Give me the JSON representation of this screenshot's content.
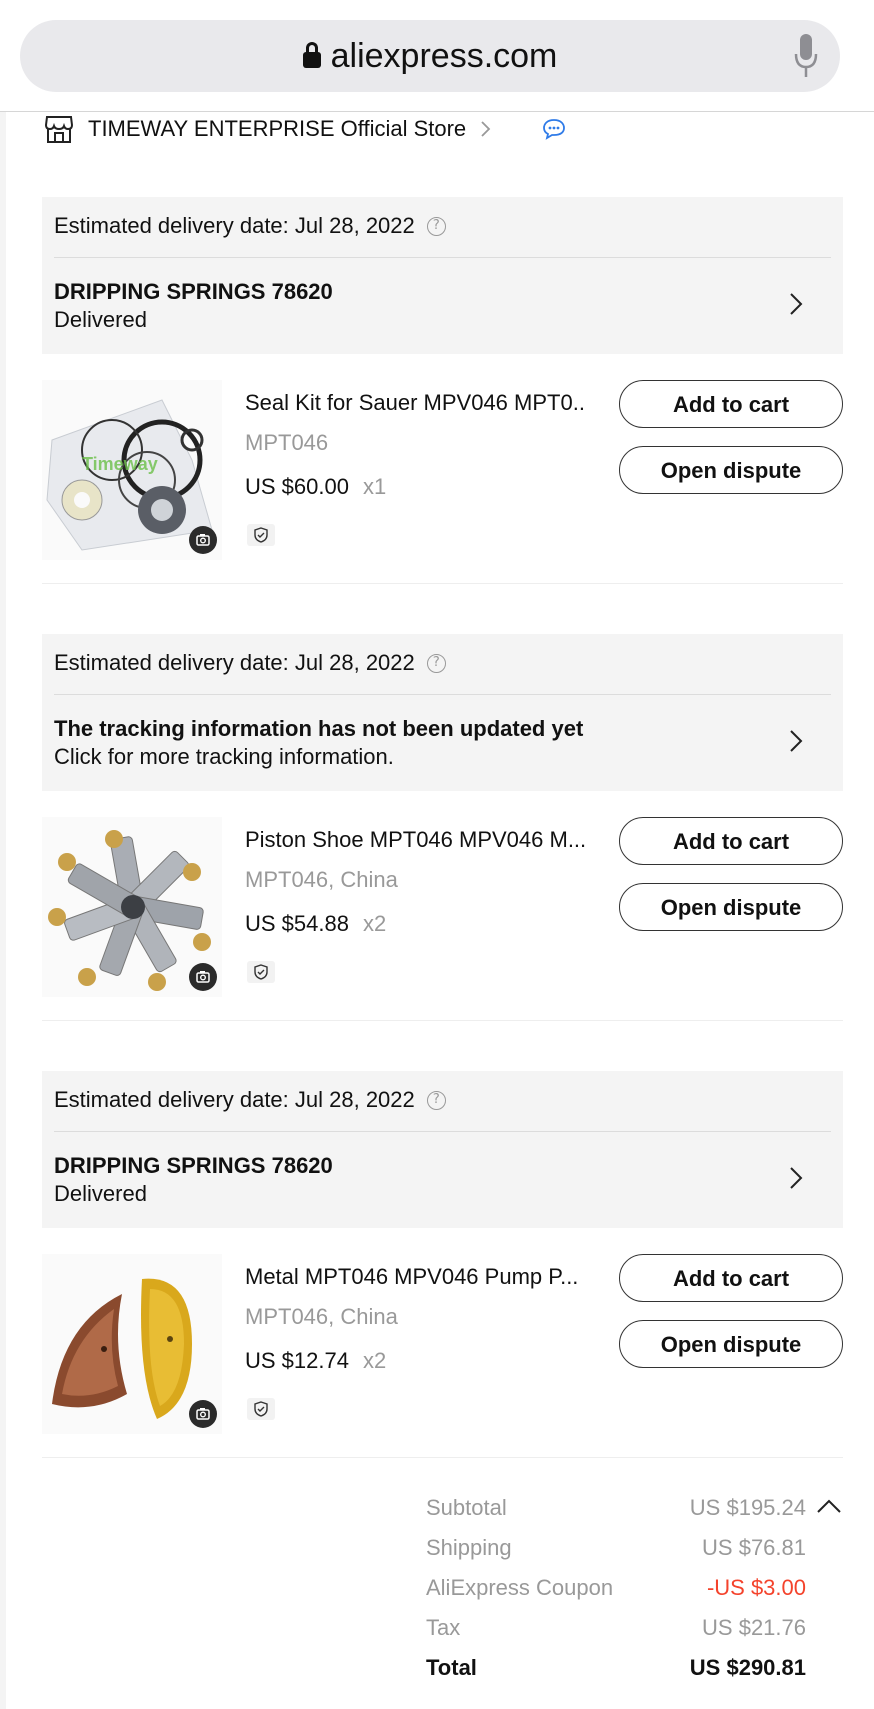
{
  "browser": {
    "url": "aliexpress.com"
  },
  "store": {
    "name": "TIMEWAY ENTERPRISE Official Store"
  },
  "packages": [
    {
      "estimated_delivery": "Estimated delivery date: Jul 28, 2022",
      "tracking_title": "DRIPPING SPRINGS 78620",
      "tracking_status": "Delivered",
      "item": {
        "title": "Seal Kit for Sauer MPV046 MPT0...",
        "variant": "MPT046",
        "price": "US $60.00",
        "quantity": "x1",
        "add_to_cart": "Add to cart",
        "open_dispute": "Open dispute"
      }
    },
    {
      "estimated_delivery": "Estimated delivery date: Jul 28, 2022",
      "tracking_title": "The tracking information has not been updated yet",
      "tracking_status": "Click for more tracking information.",
      "item": {
        "title": "Piston Shoe MPT046 MPV046 M...",
        "variant": "MPT046, China",
        "price": "US $54.88",
        "quantity": "x2",
        "add_to_cart": "Add to cart",
        "open_dispute": "Open dispute"
      }
    },
    {
      "estimated_delivery": "Estimated delivery date: Jul 28, 2022",
      "tracking_title": "DRIPPING SPRINGS 78620",
      "tracking_status": "Delivered",
      "item": {
        "title": "Metal MPT046 MPV046 Pump P...",
        "variant": "MPT046, China",
        "price": "US $12.74",
        "quantity": "x2",
        "add_to_cart": "Add to cart",
        "open_dispute": "Open dispute"
      }
    }
  ],
  "summary": {
    "subtotal_label": "Subtotal",
    "subtotal": "US $195.24",
    "shipping_label": "Shipping",
    "shipping": "US $76.81",
    "coupon_label": "AliExpress Coupon",
    "coupon": "-US $3.00",
    "tax_label": "Tax",
    "tax": "US $21.76",
    "total_label": "Total",
    "total": "US $290.81"
  },
  "colors": {
    "accent_red": "#f4432c",
    "chat_blue": "#2f7be8",
    "panel_bg": "#f4f4f4"
  }
}
